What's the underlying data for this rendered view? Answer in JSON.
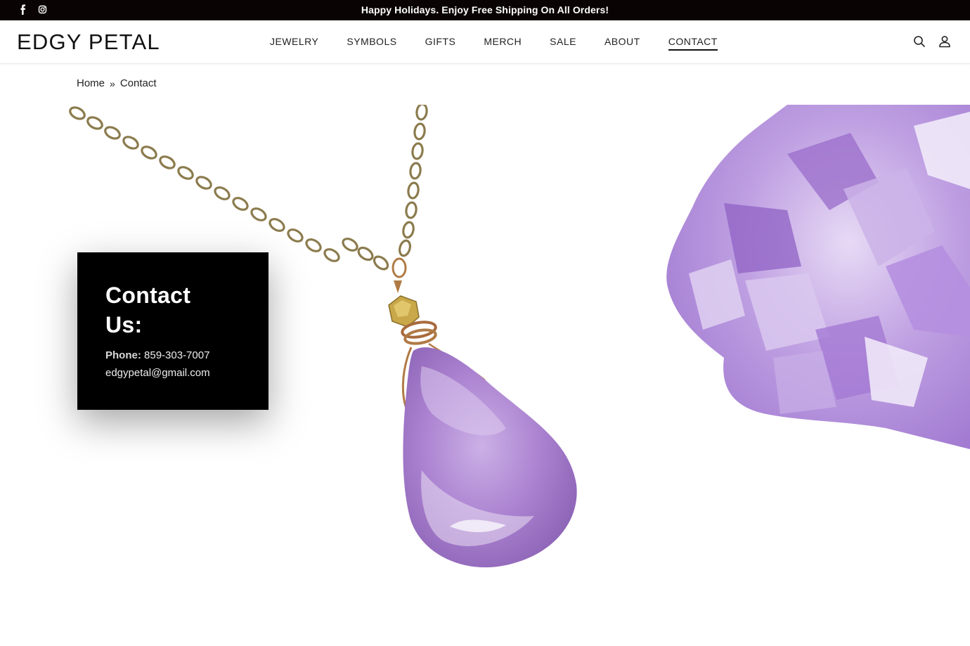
{
  "topbar": {
    "promo": "Happy Holidays. Enjoy Free Shipping On All Orders!",
    "social": [
      {
        "icon": "facebook-icon"
      },
      {
        "icon": "instagram-icon"
      }
    ]
  },
  "header": {
    "logo": "EDGY PETAL",
    "nav": [
      {
        "label": "JEWELRY"
      },
      {
        "label": "SYMBOLS"
      },
      {
        "label": "GIFTS"
      },
      {
        "label": "MERCH"
      },
      {
        "label": "SALE"
      },
      {
        "label": "ABOUT"
      },
      {
        "label": "CONTACT",
        "active": true
      }
    ],
    "tools": [
      {
        "icon": "search-icon"
      },
      {
        "icon": "account-icon"
      }
    ]
  },
  "breadcrumb": {
    "home": "Home",
    "separator": "»",
    "current": "Contact"
  },
  "contact": {
    "title": "Contact Us:",
    "phone_label": "Phone:",
    "phone": "859-303-7007",
    "email": "edgypetal@gmail.com"
  },
  "colors": {
    "topbar_bg": "#0a0303",
    "card_bg": "#000000",
    "amethyst": "#a57ac9",
    "chain": "#8a7a4a"
  }
}
